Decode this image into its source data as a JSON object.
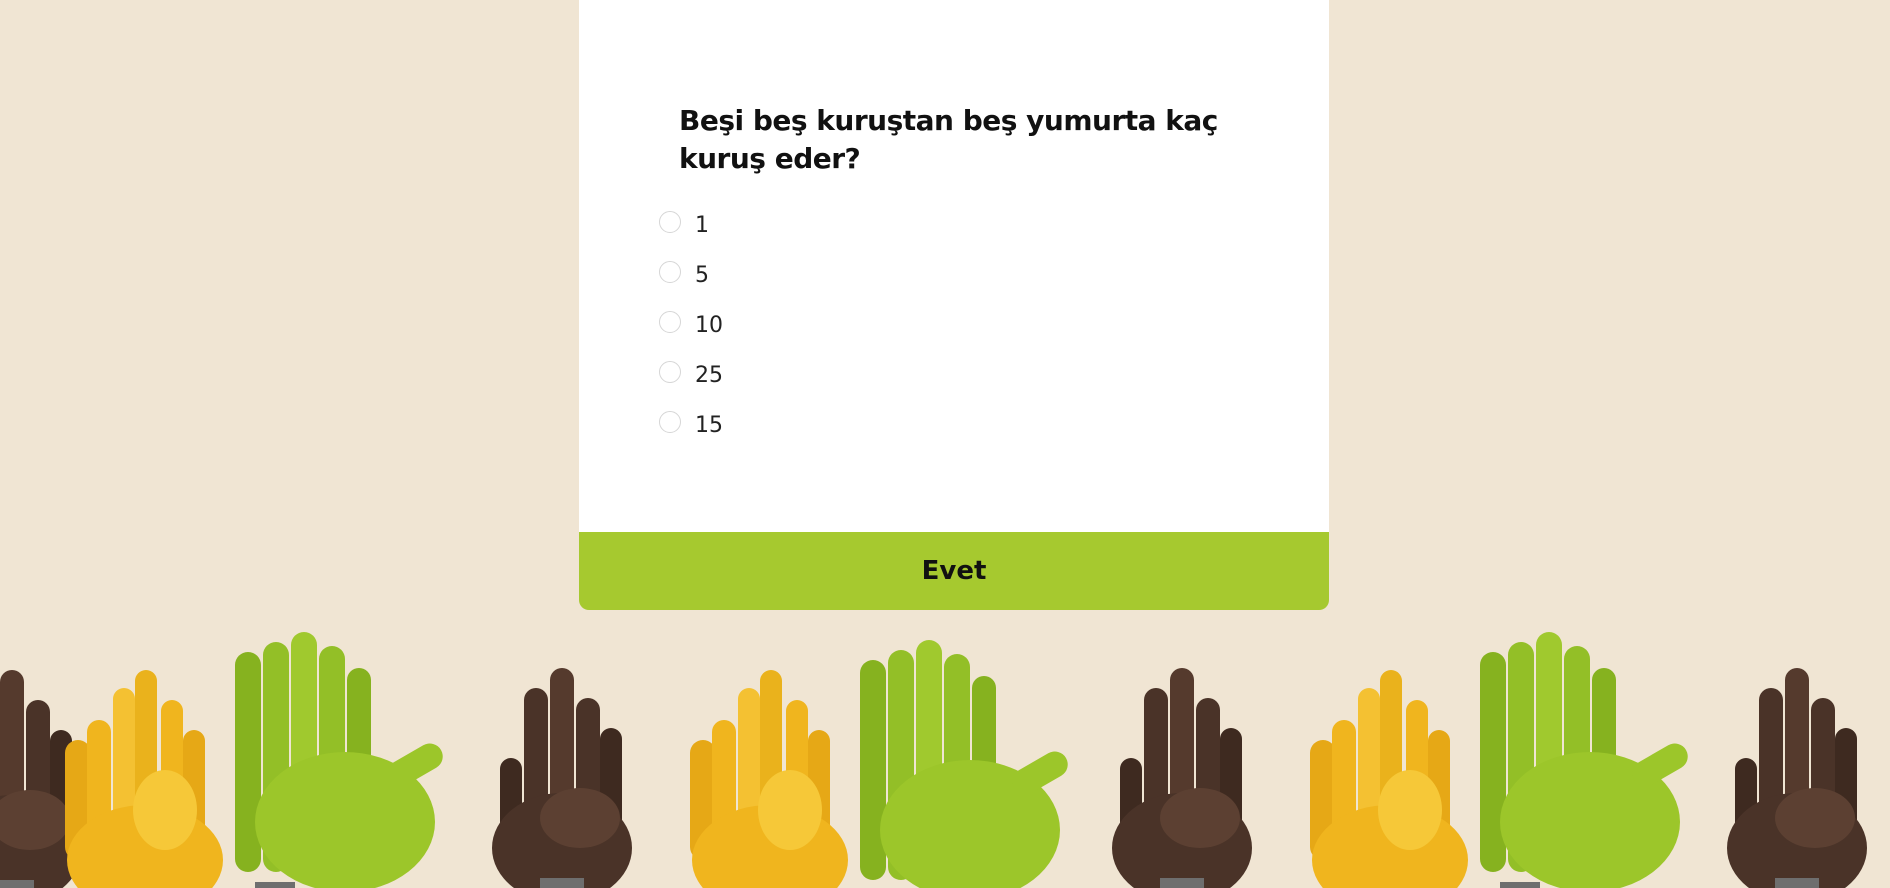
{
  "quiz": {
    "question": "Beşi beş kuruştan beş yumurta kaç kuruş eder?",
    "options": [
      "1",
      "5",
      "10",
      "25",
      "15"
    ],
    "submit_label": "Evet"
  },
  "colors": {
    "background": "#f0e5d3",
    "card": "#ffffff",
    "accent": "#a6c92f",
    "hand_yellow": "#f0b51e",
    "hand_green": "#9cc62a",
    "hand_brown": "#4a3328"
  },
  "decoration": {
    "hands_pattern": [
      "brown-peace-hand",
      "yellow-crossed-fingers-hand",
      "green-waving-hand",
      "brown-peace-hand",
      "yellow-crossed-fingers-hand",
      "green-waving-hand",
      "brown-peace-hand",
      "yellow-crossed-fingers-hand",
      "green-waving-hand",
      "brown-peace-hand"
    ]
  }
}
